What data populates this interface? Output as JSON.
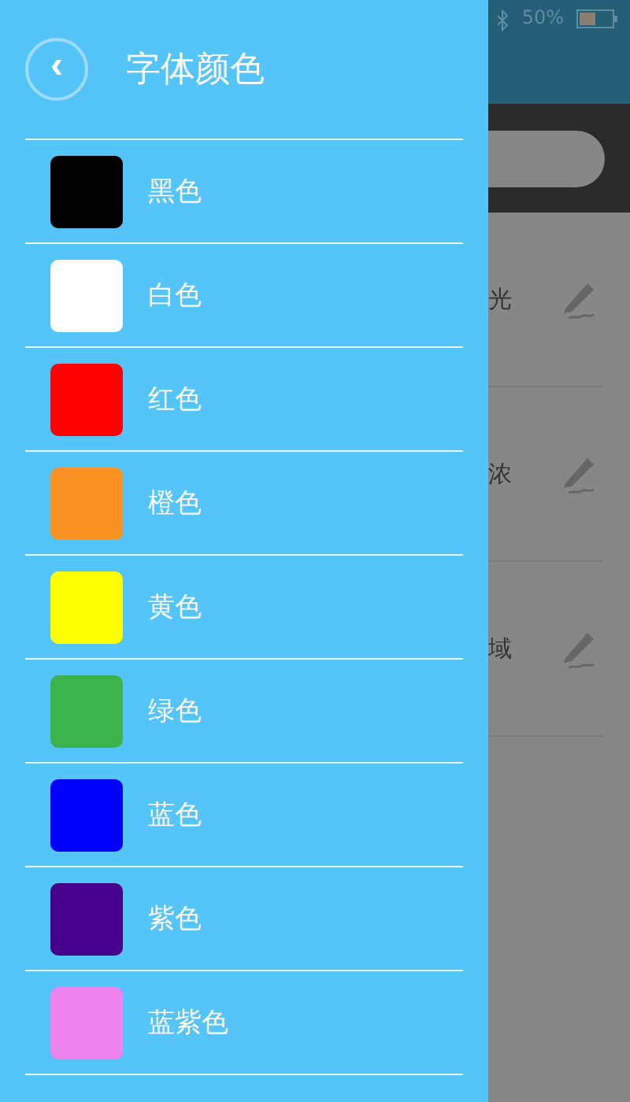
{
  "status_bar": {
    "battery": "50%"
  },
  "background_list": [
    {
      "text": "光"
    },
    {
      "text": "浓"
    },
    {
      "text": "域"
    }
  ],
  "drawer": {
    "back": "‹",
    "title": "字体颜色",
    "colors": [
      {
        "name": "黑色",
        "color": "#000000"
      },
      {
        "name": "白色",
        "color": "#ffffff"
      },
      {
        "name": "红色",
        "color": "#ff0000"
      },
      {
        "name": "橙色",
        "color": "#fa9224"
      },
      {
        "name": "黄色",
        "color": "#ffff00"
      },
      {
        "name": "绿色",
        "color": "#3cb44b"
      },
      {
        "name": "蓝色",
        "color": "#0000ff"
      },
      {
        "name": "紫色",
        "color": "#46008c"
      },
      {
        "name": "蓝紫色",
        "color": "#ee82ee"
      }
    ]
  }
}
